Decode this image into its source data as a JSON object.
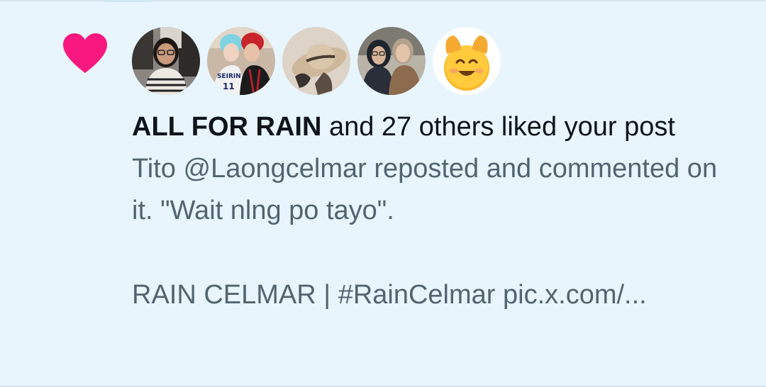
{
  "notification": {
    "type_icon": "heart-icon",
    "liker_name": "ALL FOR RAIN",
    "summary_rest": " and 27 others liked your post",
    "preview_line1": "Tito @Laongcelmar reposted and commented on it. \"Wait nlng po tayo\".",
    "preview_line2": "RAIN CELMAR | #RainCelmar pic.x.com/..."
  },
  "avatars": [
    {
      "label": "avatar-user-1"
    },
    {
      "label": "avatar-user-2"
    },
    {
      "label": "avatar-user-3"
    },
    {
      "label": "avatar-user-4"
    },
    {
      "label": "smiling-emoji-avatar"
    }
  ],
  "colors": {
    "background": "#e8f5fd",
    "heart": "#f91880",
    "primary_text": "#0f1419",
    "secondary_text": "#536471"
  }
}
